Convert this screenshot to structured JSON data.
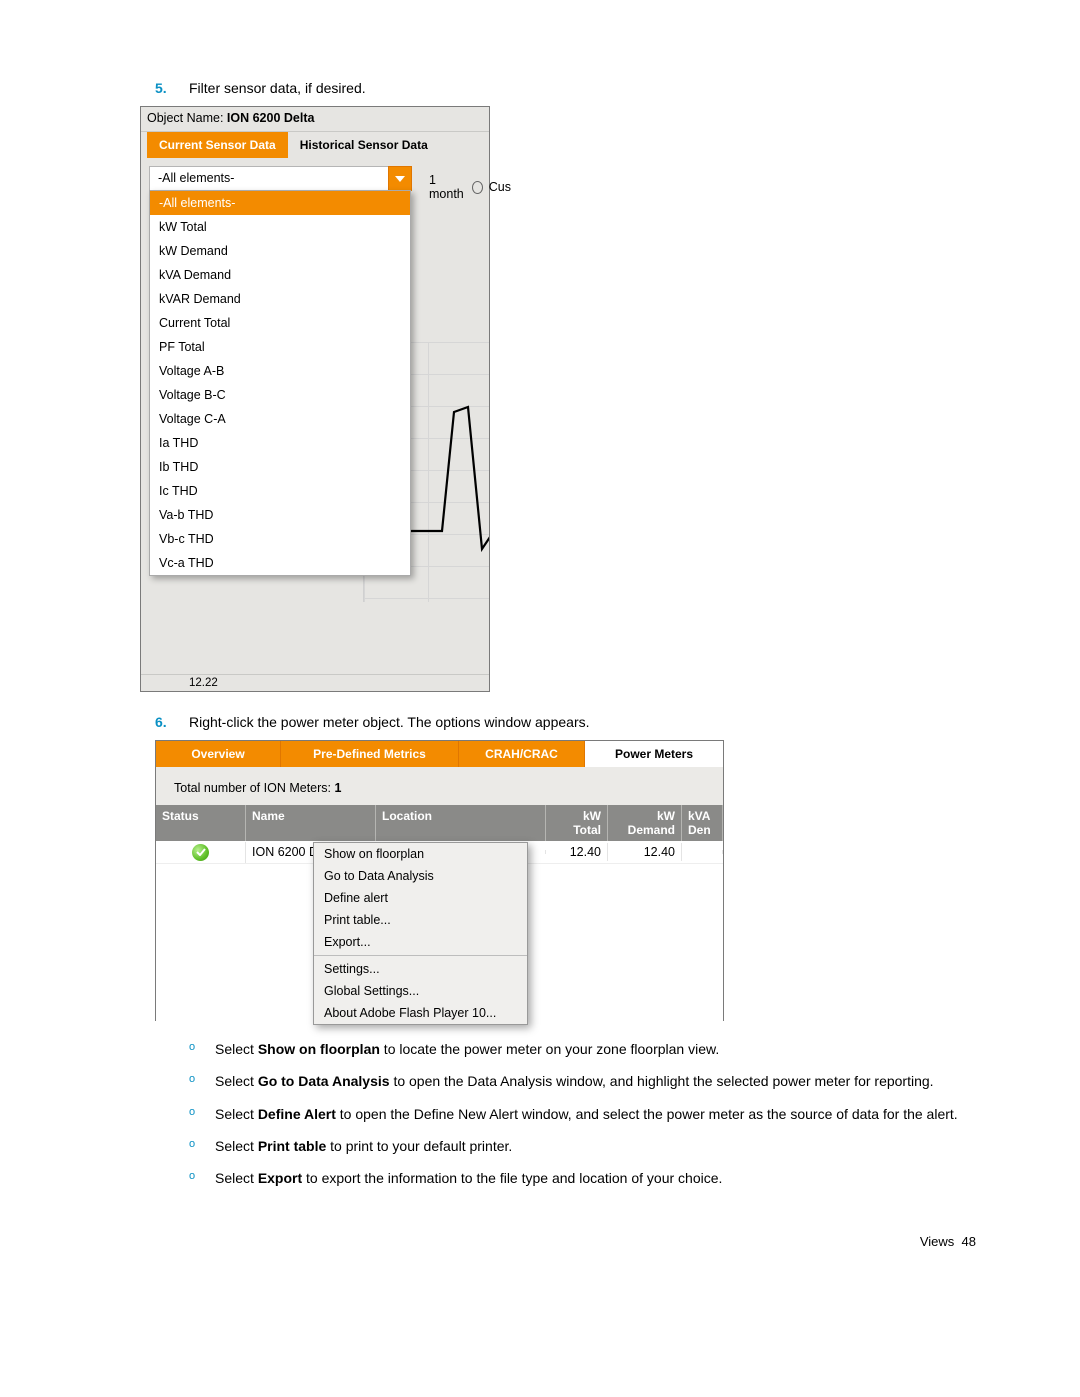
{
  "steps": {
    "s5": {
      "num": "5.",
      "text": "Filter sensor data, if desired."
    },
    "s6": {
      "num": "6.",
      "text": "Right-click the power meter object. The options window appears."
    }
  },
  "sshot1": {
    "object_label": "Object Name:",
    "object_value": "ION 6200 Delta",
    "tab_current": "Current Sensor Data",
    "tab_historical": "Historical Sensor Data",
    "dd_value": "-All elements-",
    "time_label": "1 month",
    "time_cus": "Cus",
    "bottom_num": "12.22",
    "options": [
      "-All elements-",
      "kW Total",
      "kW Demand",
      "kVA Demand",
      "kVAR Demand",
      "Current Total",
      "PF Total",
      "Voltage A-B",
      "Voltage B-C",
      "Voltage C-A",
      "Ia THD",
      "Ib THD",
      "Ic THD",
      "Va-b THD",
      "Vb-c THD",
      "Vc-a THD"
    ]
  },
  "sshot2": {
    "tabs": {
      "overview": "Overview",
      "pdm": "Pre-Defined Metrics",
      "crah": "CRAH/CRAC",
      "pm": "Power Meters"
    },
    "total_label": "Total number of ION Meters:",
    "total_value": "1",
    "headers": {
      "status": "Status",
      "name": "Name",
      "location": "Location",
      "kwt": "kW Total",
      "kwd": "kW Demand",
      "kvad": "kVA Den"
    },
    "row": {
      "name": "ION 6200 Delta",
      "kwt": "12.40",
      "kwd": "12.40"
    },
    "ctx": {
      "g1": [
        "Show on floorplan",
        "Go to Data Analysis",
        "Define alert",
        "Print table...",
        "Export..."
      ],
      "g2": [
        "Settings...",
        "Global Settings...",
        "About Adobe Flash Player 10..."
      ]
    }
  },
  "bullets": {
    "b1a": "Select ",
    "b1b": "Show on floorplan",
    "b1c": " to locate the power meter on your zone floorplan view.",
    "b2a": "Select ",
    "b2b": "Go to Data Analysis",
    "b2c": " to open the Data Analysis window, and highlight the selected power meter for reporting.",
    "b3a": "Select ",
    "b3b": "Define Alert",
    "b3c": " to open the Define New Alert window, and select the power meter as the source of data for the alert.",
    "b4a": "Select ",
    "b4b": "Print table",
    "b4c": " to print to your default printer.",
    "b5a": "Select ",
    "b5b": "Export",
    "b5c": " to export the information to the file type and location of your choice."
  },
  "footer": {
    "section": "Views",
    "page": "48"
  },
  "marks": {
    "o": "o"
  }
}
